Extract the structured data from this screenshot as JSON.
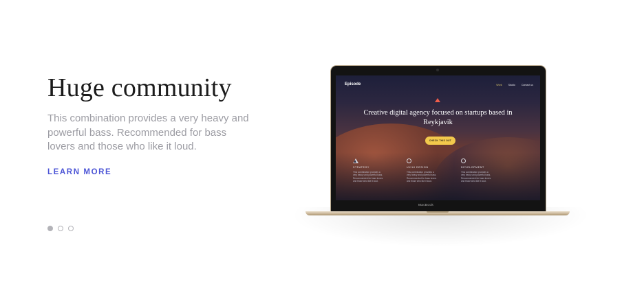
{
  "hero": {
    "title": "Huge community",
    "description": "This combination provides a very heavy and powerful bass. Recommended for bass lovers and those who like it loud.",
    "cta": "LEARN MORE",
    "slides": {
      "count": 3,
      "active": 1
    }
  },
  "laptop": {
    "brand": "MacBook",
    "site": {
      "logo": "Episode",
      "nav": [
        "Work",
        "Studio",
        "Contact us"
      ],
      "headline": "Creative digital agency focused on startups based in Reykjavik",
      "button": "CHECK THIS OUT",
      "features": [
        {
          "icon": "triangle-icon",
          "title": "STRATEGY",
          "text": "This combination provides a very heavy and powerful bass. Recommended for bass lovers and those who like it loud."
        },
        {
          "icon": "circle-icon",
          "title": "UX/UI DESIGN",
          "text": "This combination provides a very heavy and powerful bass. Recommended for bass lovers and those who like it loud."
        },
        {
          "icon": "circle-icon",
          "title": "DEVELOPMENT",
          "text": "This combination provides a very heavy and powerful bass. Recommended for bass lovers and those who like it loud."
        }
      ]
    }
  },
  "colors": {
    "accent": "#4c55d6",
    "title": "#1b1b1b",
    "muted": "#9c9ca3",
    "button": "#f2c94c"
  }
}
